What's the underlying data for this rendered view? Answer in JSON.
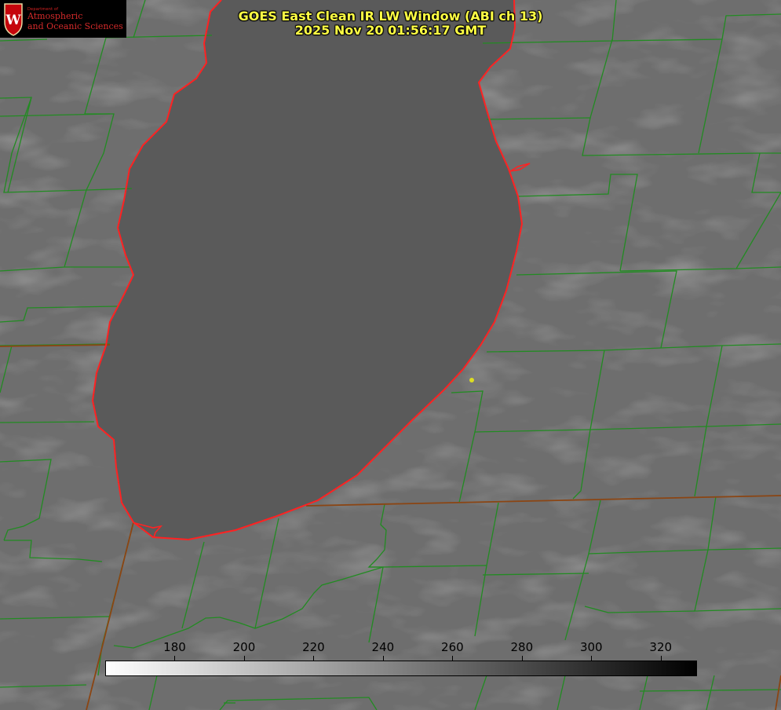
{
  "logo": {
    "department": "Department of",
    "line1": "Atmospheric",
    "line2": "and Oceanic Sciences",
    "seal_letter": "W"
  },
  "title": {
    "line1": "GOES East Clean IR LW Window (ABI ch 13)",
    "line2": "2025 Nov 20 01:56:17 GMT"
  },
  "colorbar": {
    "min": 160,
    "max": 330,
    "ticks": [
      "180",
      "200",
      "220",
      "240",
      "260",
      "280",
      "300",
      "320"
    ],
    "start_color": "#ffffff",
    "end_color": "#000000"
  },
  "colors": {
    "land": "#6e6e6e",
    "lake": "#5a5a5a",
    "county_lines": "#228b22",
    "shoreline": "#ff2222",
    "state_lines": "#8b4513",
    "marker": "#dddd22"
  }
}
